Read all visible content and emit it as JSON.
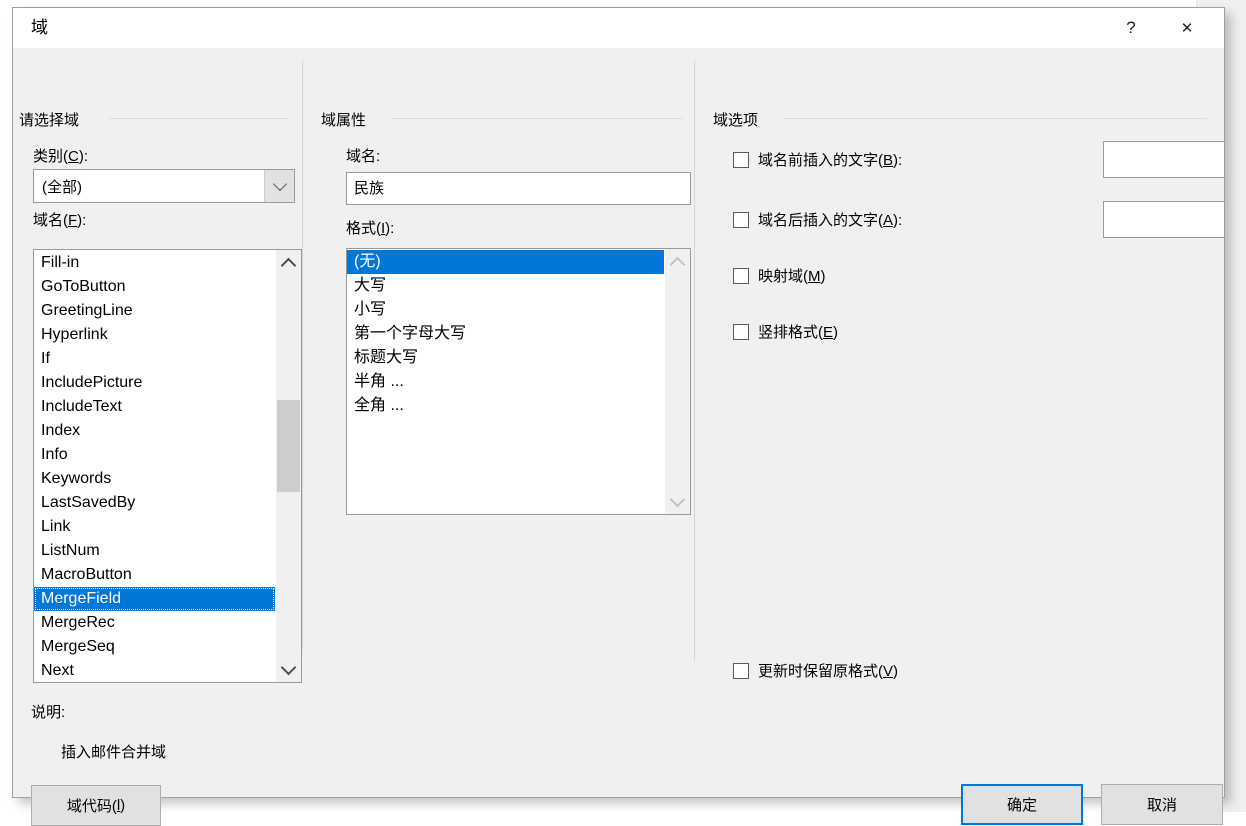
{
  "window": {
    "title": "域",
    "help_icon": "?",
    "close_icon": "✕"
  },
  "left_panel": {
    "group_caption": "请选择域",
    "category_label_prefix": "类别(",
    "category_accel": "C",
    "category_label_suffix": "):",
    "category_value": "(全部)",
    "fieldname_label_prefix": "域名(",
    "fieldname_accel": "F",
    "fieldname_label_suffix": "):",
    "field_list": [
      {
        "label": "Fill-in",
        "selected": false
      },
      {
        "label": "GoToButton",
        "selected": false
      },
      {
        "label": "GreetingLine",
        "selected": false
      },
      {
        "label": "Hyperlink",
        "selected": false
      },
      {
        "label": "If",
        "selected": false
      },
      {
        "label": "IncludePicture",
        "selected": false
      },
      {
        "label": "IncludeText",
        "selected": false
      },
      {
        "label": "Index",
        "selected": false
      },
      {
        "label": "Info",
        "selected": false
      },
      {
        "label": "Keywords",
        "selected": false
      },
      {
        "label": "LastSavedBy",
        "selected": false
      },
      {
        "label": "Link",
        "selected": false
      },
      {
        "label": "ListNum",
        "selected": false
      },
      {
        "label": "MacroButton",
        "selected": false
      },
      {
        "label": "MergeField",
        "selected": true
      },
      {
        "label": "MergeRec",
        "selected": false
      },
      {
        "label": "MergeSeq",
        "selected": false
      },
      {
        "label": "Next",
        "selected": false
      }
    ],
    "description_label": "说明:",
    "description_value": "插入邮件合并域",
    "field_codes_button_prefix": "域代码(",
    "field_codes_accel": "l",
    "field_codes_button_suffix": ")"
  },
  "middle_panel": {
    "group_caption": "域属性",
    "fieldname_label": "域名:",
    "fieldname_value": "民族",
    "format_label_prefix": "格式(",
    "format_accel": "I",
    "format_label_suffix": "):",
    "format_list": [
      {
        "label": "(无)",
        "selected": true
      },
      {
        "label": "大写",
        "selected": false
      },
      {
        "label": "小写",
        "selected": false
      },
      {
        "label": "第一个字母大写",
        "selected": false
      },
      {
        "label": "标题大写",
        "selected": false
      },
      {
        "label": "半角 ...",
        "selected": false
      },
      {
        "label": "全角 ...",
        "selected": false
      }
    ]
  },
  "right_panel": {
    "group_caption": "域选项",
    "options": [
      {
        "label_prefix": "域名前插入的文字(",
        "accel": "B",
        "label_suffix": "):",
        "checked": false,
        "has_input": true,
        "input_value": "",
        "name": "text-before-field"
      },
      {
        "label_prefix": "域名后插入的文字(",
        "accel": "A",
        "label_suffix": "):",
        "checked": false,
        "has_input": true,
        "input_value": "",
        "name": "text-after-field"
      },
      {
        "label_prefix": "映射域(",
        "accel": "M",
        "label_suffix": ")",
        "checked": false,
        "has_input": false,
        "name": "mapped-field"
      },
      {
        "label_prefix": "竖排格式(",
        "accel": "E",
        "label_suffix": ")",
        "checked": false,
        "has_input": false,
        "name": "vertical-formatting"
      }
    ],
    "preserve_formatting": {
      "label_prefix": "更新时保留原格式(",
      "accel": "V",
      "label_suffix": ")",
      "checked": false
    }
  },
  "footer": {
    "ok_label": "确定",
    "cancel_label": "取消"
  },
  "colors": {
    "accent": "#0078d7",
    "dialog_bg": "#f0f0f0",
    "titlebar_bg": "#ffffff",
    "control_bg": "#ffffff",
    "border": "#9a9a9a",
    "selection": "#0078d7"
  }
}
